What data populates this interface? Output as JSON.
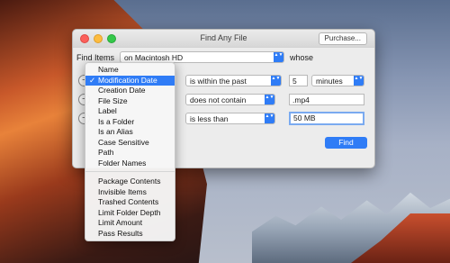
{
  "window": {
    "title": "Find Any File",
    "purchase_label": "Purchase..."
  },
  "search": {
    "find_items_label": "Find Items",
    "location_value": "on Macintosh HD",
    "whose_label": "whose",
    "rows": [
      {
        "operator": "is within the past",
        "value": "5",
        "unit": "minutes"
      },
      {
        "operator": "does not contain",
        "value": ".mp4"
      },
      {
        "operator": "is less than",
        "value": "50 MB"
      }
    ],
    "find_button": "Find"
  },
  "attribute_menu": {
    "selected": "Modification Date",
    "check_glyph": "✓",
    "items_group1": [
      "Name",
      "Modification Date",
      "Creation Date",
      "File Size",
      "Label",
      "Is a Folder",
      "Is an Alias",
      "Case Sensitive",
      "Path",
      "Folder Names"
    ],
    "items_group2": [
      "Package Contents",
      "Invisible Items",
      "Trashed Contents",
      "Limit Folder Depth",
      "Limit Amount",
      "Pass Results"
    ]
  },
  "icons": {
    "stepper": "−",
    "popup_arrows": "▲▼"
  }
}
